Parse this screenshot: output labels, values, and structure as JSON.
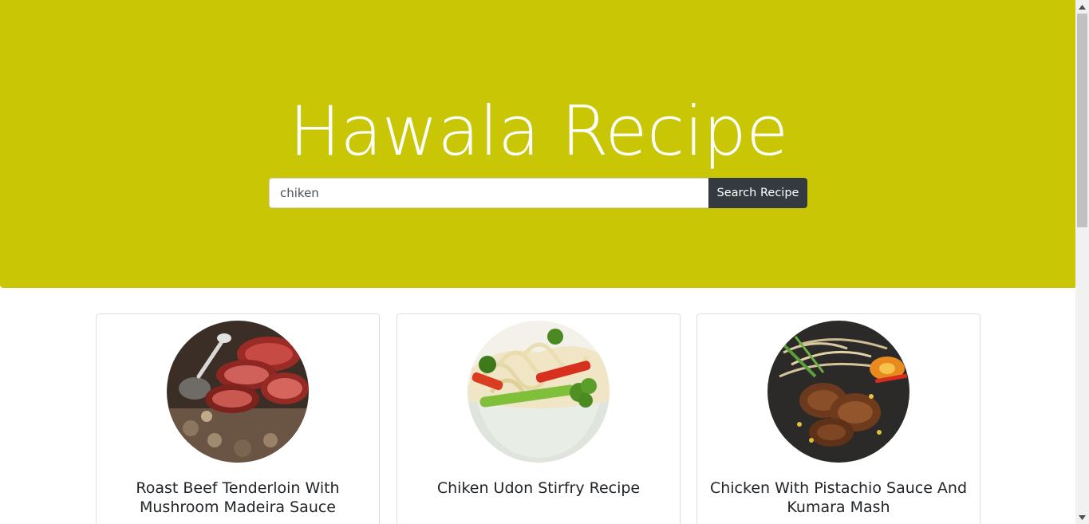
{
  "hero": {
    "title": "Hawala Recipe",
    "background": "#c8c605"
  },
  "search": {
    "value": "chiken",
    "button_label": "Search Recipe",
    "button_color": "#343a40"
  },
  "recipes": [
    {
      "title": "Roast Beef Tenderloin With Mushroom Madeira Sauce",
      "image_icon": "roast-beef-photo"
    },
    {
      "title": "Chiken Udon Stirfry Recipe",
      "image_icon": "udon-stirfry-photo"
    },
    {
      "title": "Chicken With Pistachio Sauce And Kumara Mash",
      "image_icon": "chicken-pistachio-photo"
    }
  ]
}
